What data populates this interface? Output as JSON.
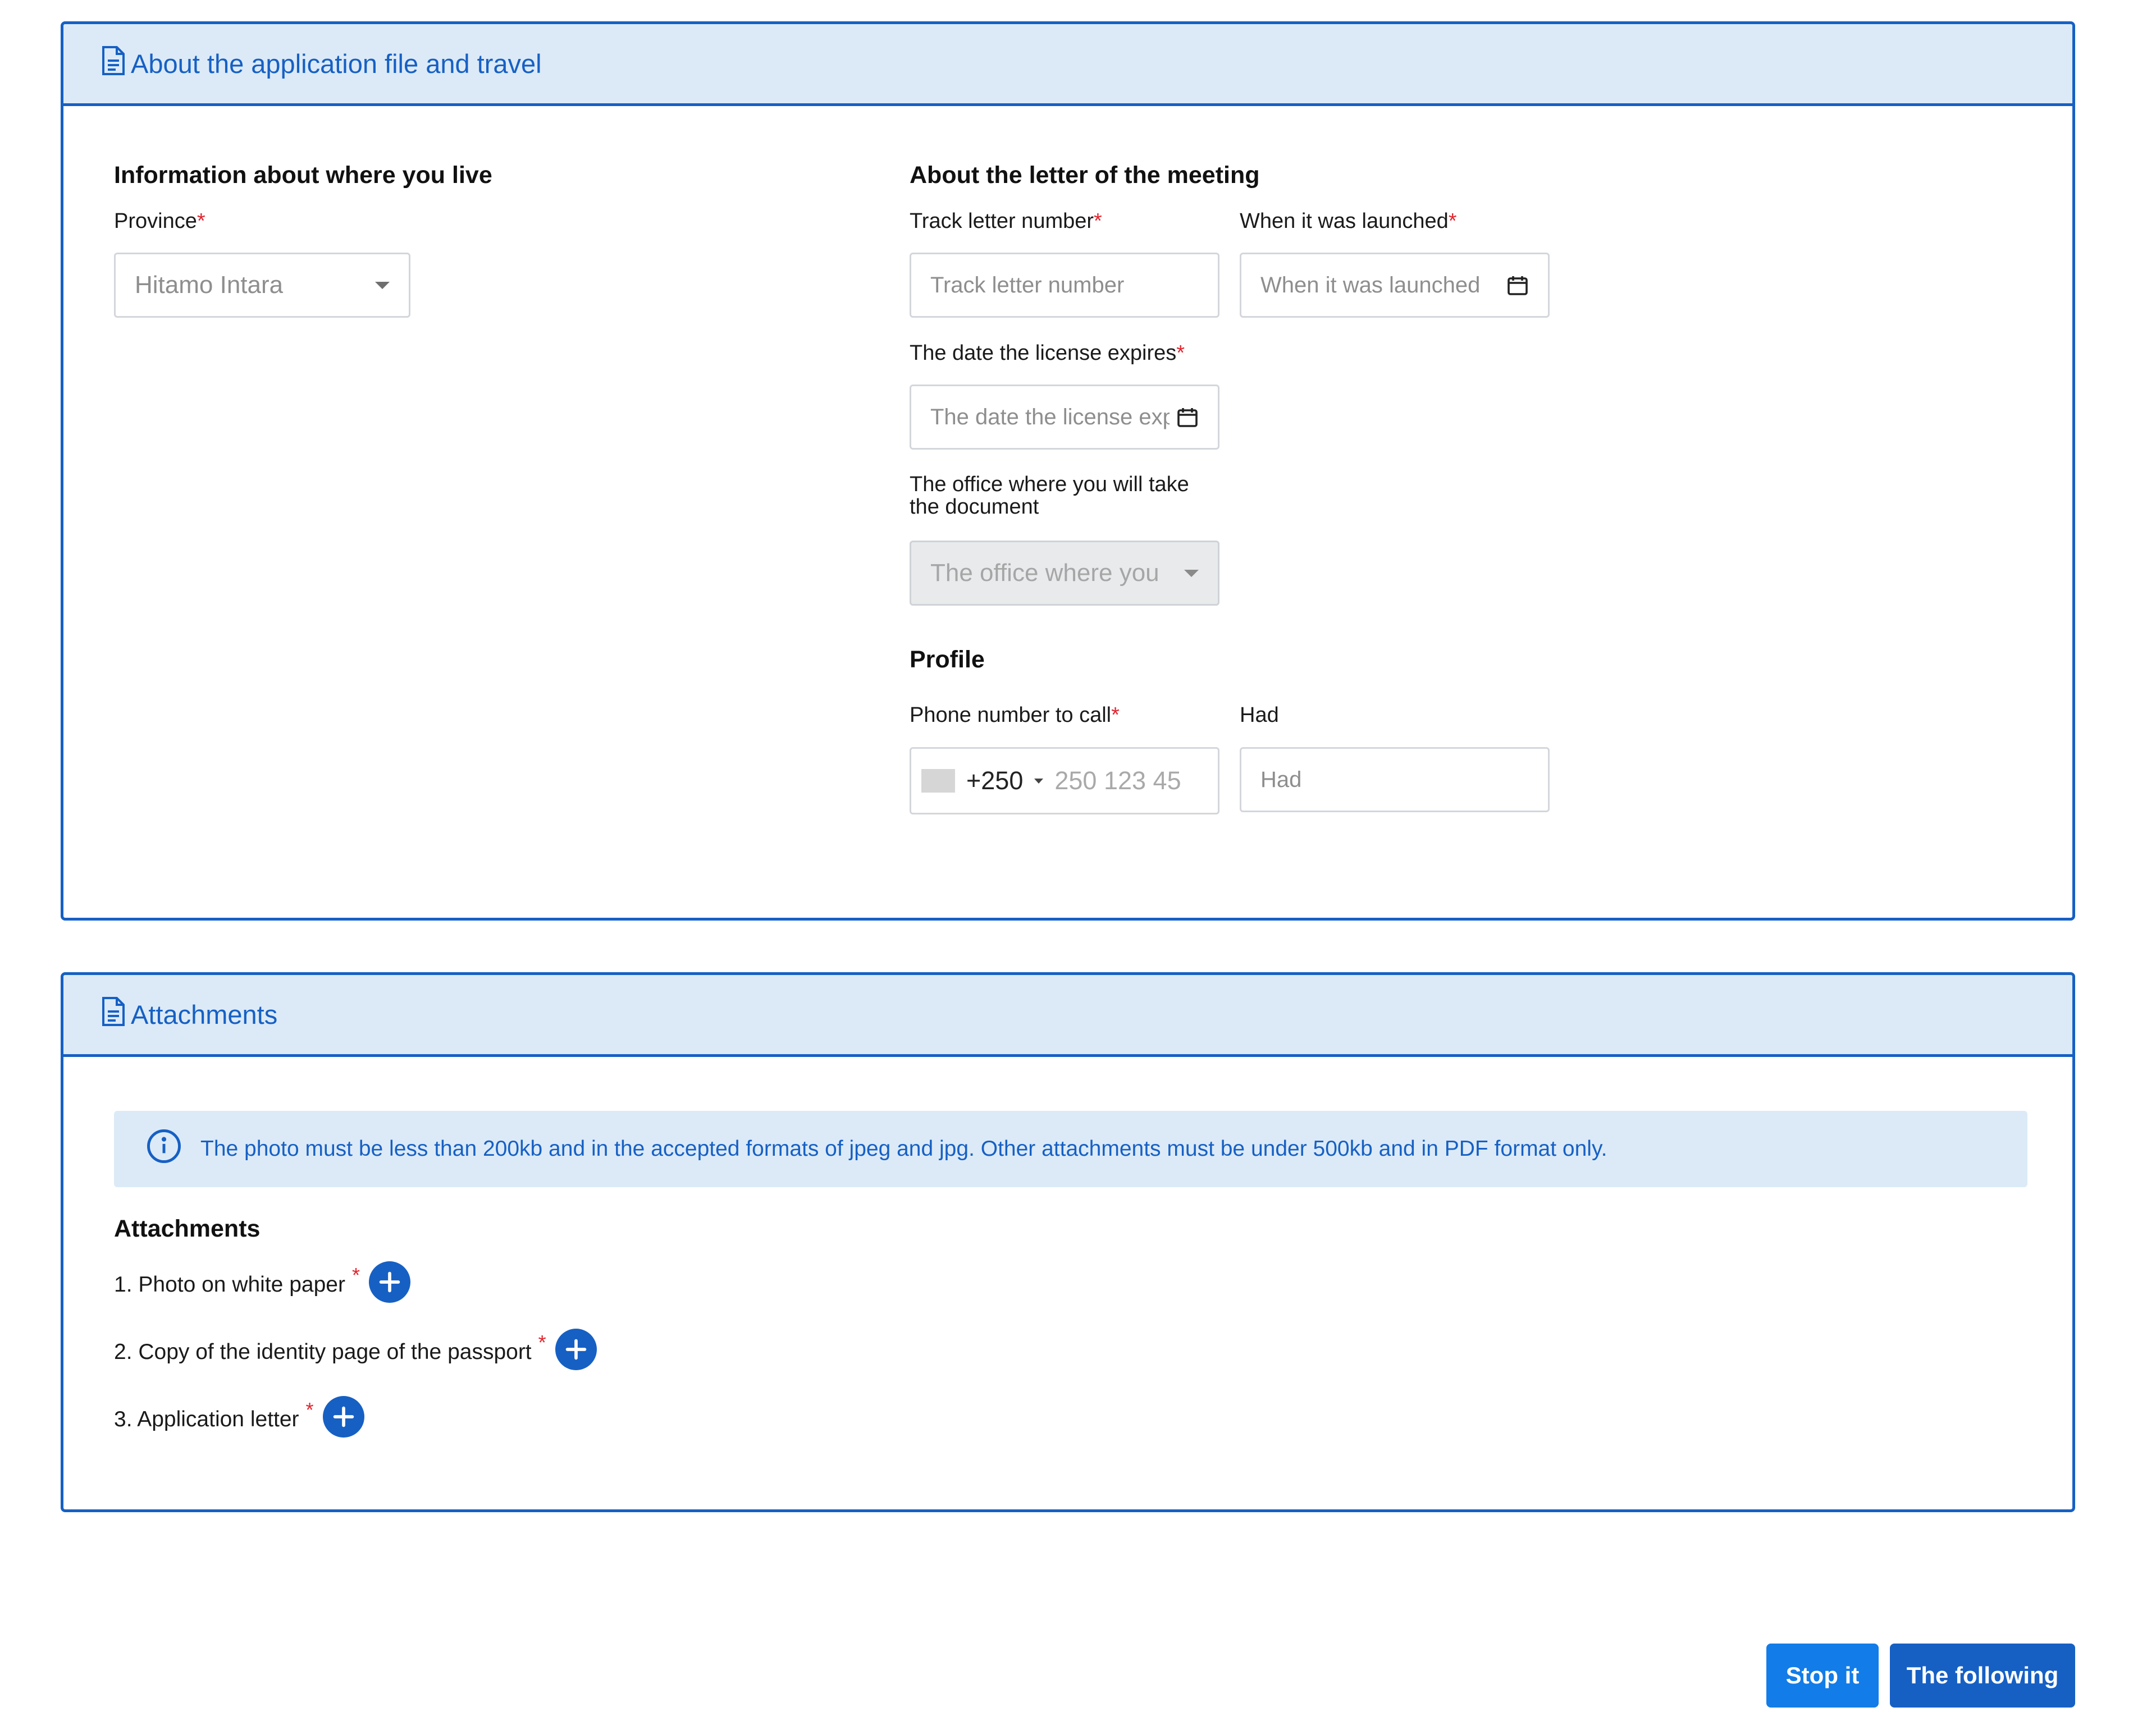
{
  "section1": {
    "title": "About the application file and travel",
    "residence": {
      "heading": "Information about where you live",
      "province_label": "Province",
      "province_value": "Hitamo Intara"
    },
    "meeting_letter": {
      "heading": "About the letter of the meeting",
      "track_label": "Track letter number",
      "track_placeholder": "Track letter number",
      "launched_label": "When it was launched",
      "launched_placeholder": "When it was launched",
      "expiry_label": "The date the license expires",
      "expiry_placeholder": "The date the license exp",
      "office_label": "The office where you will take the document",
      "office_placeholder": "The office where you"
    },
    "profile": {
      "heading": "Profile",
      "phone_label": "Phone number to call",
      "dial_code": "+250",
      "phone_placeholder": "250 123 45",
      "had_label": "Had",
      "had_placeholder": "Had"
    }
  },
  "section2": {
    "title": "Attachments",
    "notice": "The photo must be less than 200kb and in the accepted formats of jpeg and jpg. Other attachments must be under 500kb and in PDF format only.",
    "list_heading": "Attachments",
    "items": [
      {
        "label": "1. Photo on white paper"
      },
      {
        "label": "2. Copy of the identity page of the passport"
      },
      {
        "label": "3. Application letter"
      }
    ]
  },
  "required_mark": "*",
  "buttons": {
    "stop": "Stop it",
    "next": "The following"
  },
  "colors": {
    "primary": "#1660c4",
    "header_bg": "#dceaf7",
    "required": "#e0262f",
    "stop_button": "#127ce8"
  }
}
